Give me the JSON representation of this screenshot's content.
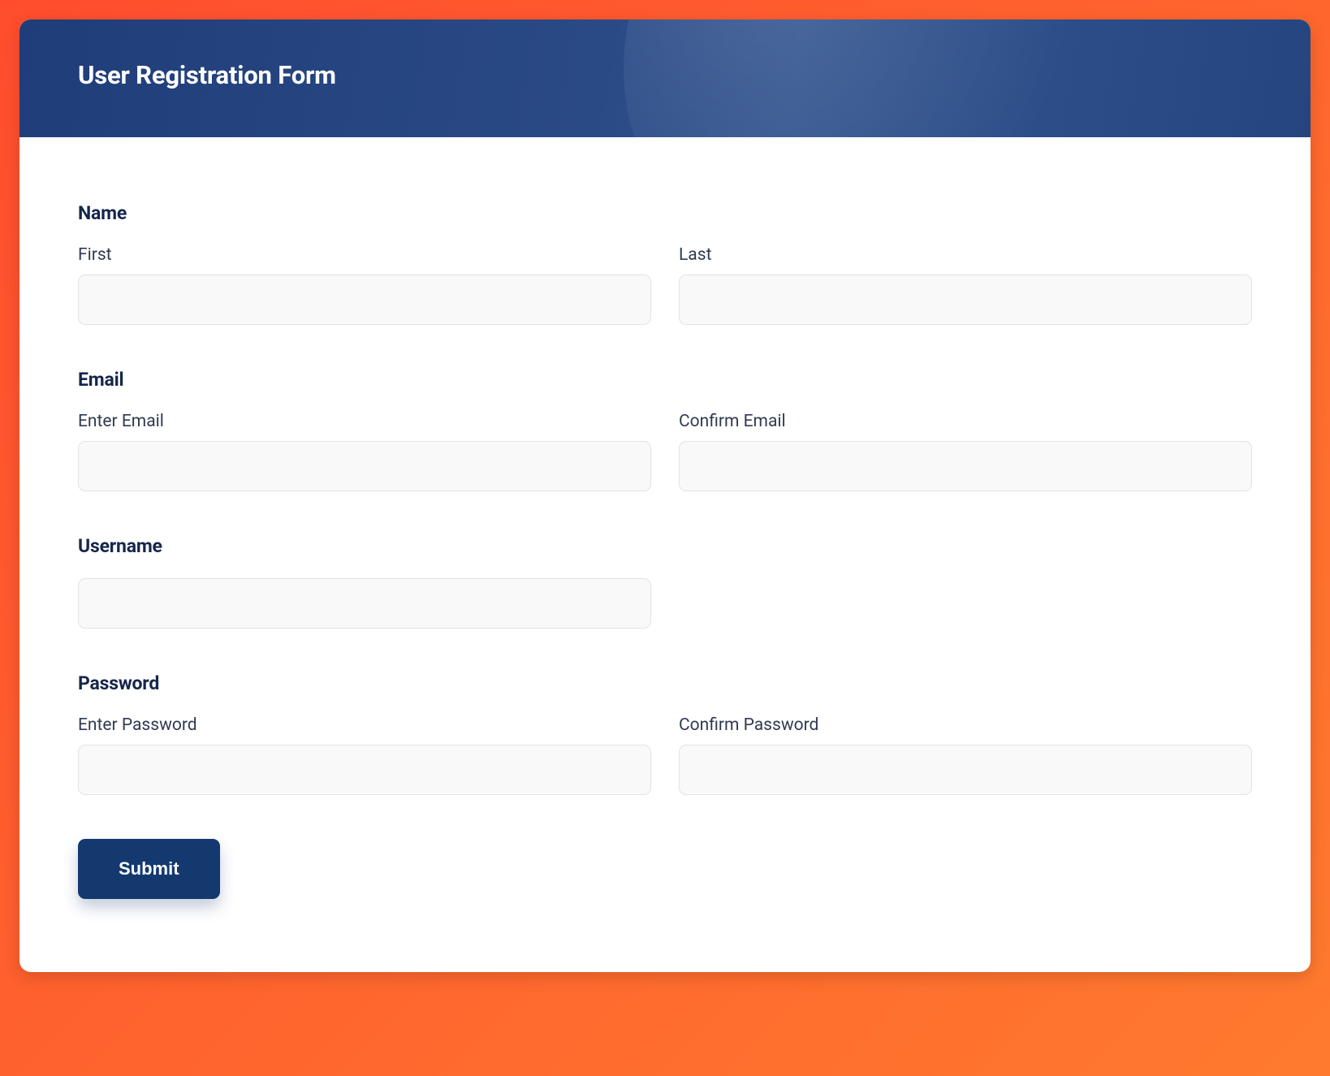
{
  "header": {
    "title": "User Registration Form"
  },
  "sections": {
    "name": {
      "title": "Name",
      "first_label": "First",
      "last_label": "Last",
      "first_value": "",
      "last_value": ""
    },
    "email": {
      "title": "Email",
      "enter_label": "Enter Email",
      "confirm_label": "Confirm Email",
      "enter_value": "",
      "confirm_value": ""
    },
    "username": {
      "title": "Username",
      "value": ""
    },
    "password": {
      "title": "Password",
      "enter_label": "Enter Password",
      "confirm_label": "Confirm Password",
      "enter_value": "",
      "confirm_value": ""
    }
  },
  "submit": {
    "label": "Submit"
  }
}
